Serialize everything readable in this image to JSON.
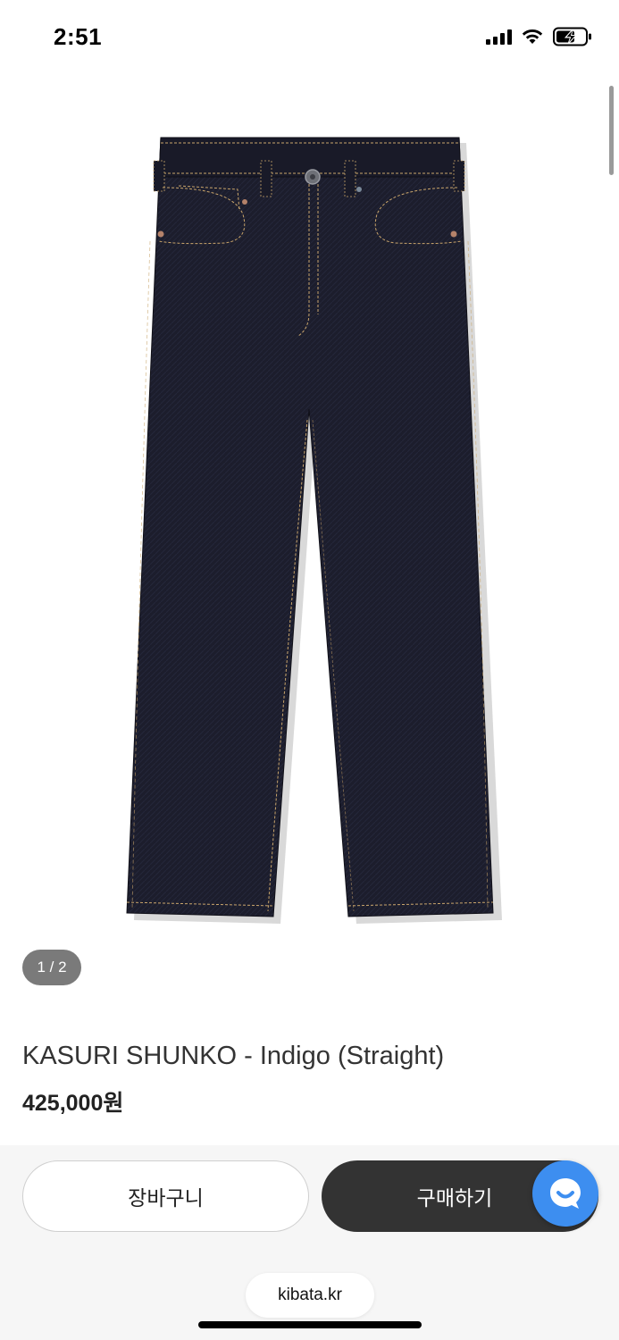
{
  "status_bar": {
    "time": "2:51"
  },
  "gallery": {
    "pager": "1 / 2"
  },
  "product": {
    "title": "KASURI SHUNKO - Indigo (Straight)",
    "price": "425,000원"
  },
  "actions": {
    "cart_label": "장바구니",
    "buy_label": "구매하기",
    "chat_icon": "chat-bubble-icon"
  },
  "browser": {
    "url": "kibata.kr"
  },
  "colors": {
    "buy_button": "#333333",
    "chat_button": "#3d8ef0",
    "denim": "#1b1c2b",
    "stitching": "#c9a56b"
  }
}
